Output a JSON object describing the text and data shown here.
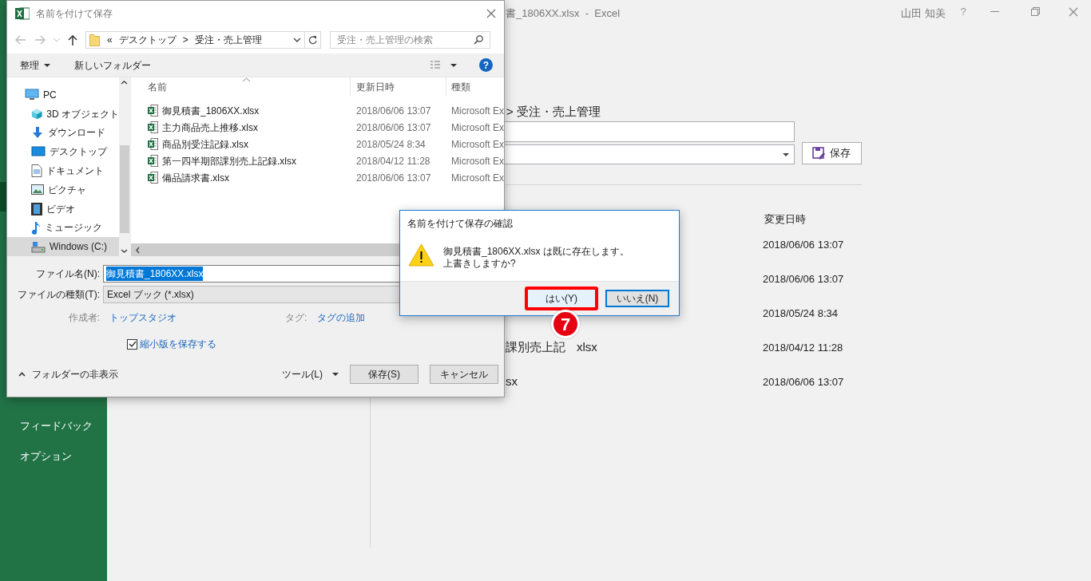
{
  "excel": {
    "title": "書_1806XX.xlsx  -  Excel",
    "user": "山田 知美",
    "help": "?",
    "sidebar": [
      {
        "label": "フィードバック"
      },
      {
        "label": "オプション"
      }
    ],
    "path": "> 受注・売上管理",
    "save_button": "保存",
    "date_header": "変更日時",
    "files": [
      {
        "date": "2018/06/06 13:07"
      },
      {
        "date": "2018/06/06 13:07"
      },
      {
        "date": "2018/05/24 8:34"
      },
      {
        "name": "課別売上記",
        "name_end": "xlsx",
        "date": "2018/04/12 11:28"
      },
      {
        "name": "sx",
        "date": "2018/06/06 13:07"
      }
    ]
  },
  "save_dialog": {
    "title": "名前を付けて保存",
    "address": {
      "chevrons": "«",
      "parts": [
        "デスクトップ",
        "受注・売上管理"
      ],
      "separator": ">"
    },
    "search": {
      "placeholder": "受注・売上管理の検索"
    },
    "toolbar": {
      "organize": "整理",
      "new_folder": "新しいフォルダー",
      "help": "?"
    },
    "nav": [
      {
        "label": "PC",
        "selected": false,
        "children": [
          {
            "label": "3D オブジェクト",
            "selected": false
          },
          {
            "label": "ダウンロード",
            "selected": false
          },
          {
            "label": "デスクトップ",
            "selected": false
          },
          {
            "label": "ドキュメント",
            "selected": false
          },
          {
            "label": "ピクチャ",
            "selected": false
          },
          {
            "label": "ビデオ",
            "selected": false
          },
          {
            "label": "ミュージック",
            "selected": false
          },
          {
            "label": "Windows (C:)",
            "selected": true
          }
        ]
      }
    ],
    "columns": [
      "名前",
      "更新日時",
      "種類"
    ],
    "rows": [
      {
        "name": "御見積書_1806XX.xlsx",
        "date": "2018/06/06 13:07",
        "type": "Microsoft Ex"
      },
      {
        "name": "主力商品売上推移.xlsx",
        "date": "2018/06/06 13:07",
        "type": "Microsoft Ex"
      },
      {
        "name": "商品別受注記録.xlsx",
        "date": "2018/05/24 8:34",
        "type": "Microsoft Ex"
      },
      {
        "name": "第一四半期部課別売上記録.xlsx",
        "date": "2018/04/12 11:28",
        "type": "Microsoft Ex"
      },
      {
        "name": "備品請求書.xlsx",
        "date": "2018/06/06 13:07",
        "type": "Microsoft Ex"
      }
    ],
    "filename_label": "ファイル名(N):",
    "filename": "御見積書_1806XX.xlsx",
    "filetype_label": "ファイルの種類(T):",
    "filetype": "Excel ブック (*.xlsx)",
    "author_label": "作成者:",
    "author": "トップスタジオ",
    "tag_label": "タグ:",
    "tag": "タグの追加",
    "thumbnail": {
      "label": "縮小版を保存する",
      "checked": true
    },
    "hide_folders": "フォルダーの非表示",
    "tools": "ツール(L)",
    "save": "保存(S)",
    "cancel": "キャンセル"
  },
  "confirm_dialog": {
    "title": "名前を付けて保存の確認",
    "message": [
      "御見積書_1806XX.xlsx は既に存在します。",
      "上書きしますか?"
    ],
    "buttons": [
      {
        "label": "はい(Y)",
        "annotated": true,
        "focused": false
      },
      {
        "label": "いいえ(N)",
        "annotated": false,
        "focused": true
      }
    ]
  },
  "step_marker": "7"
}
